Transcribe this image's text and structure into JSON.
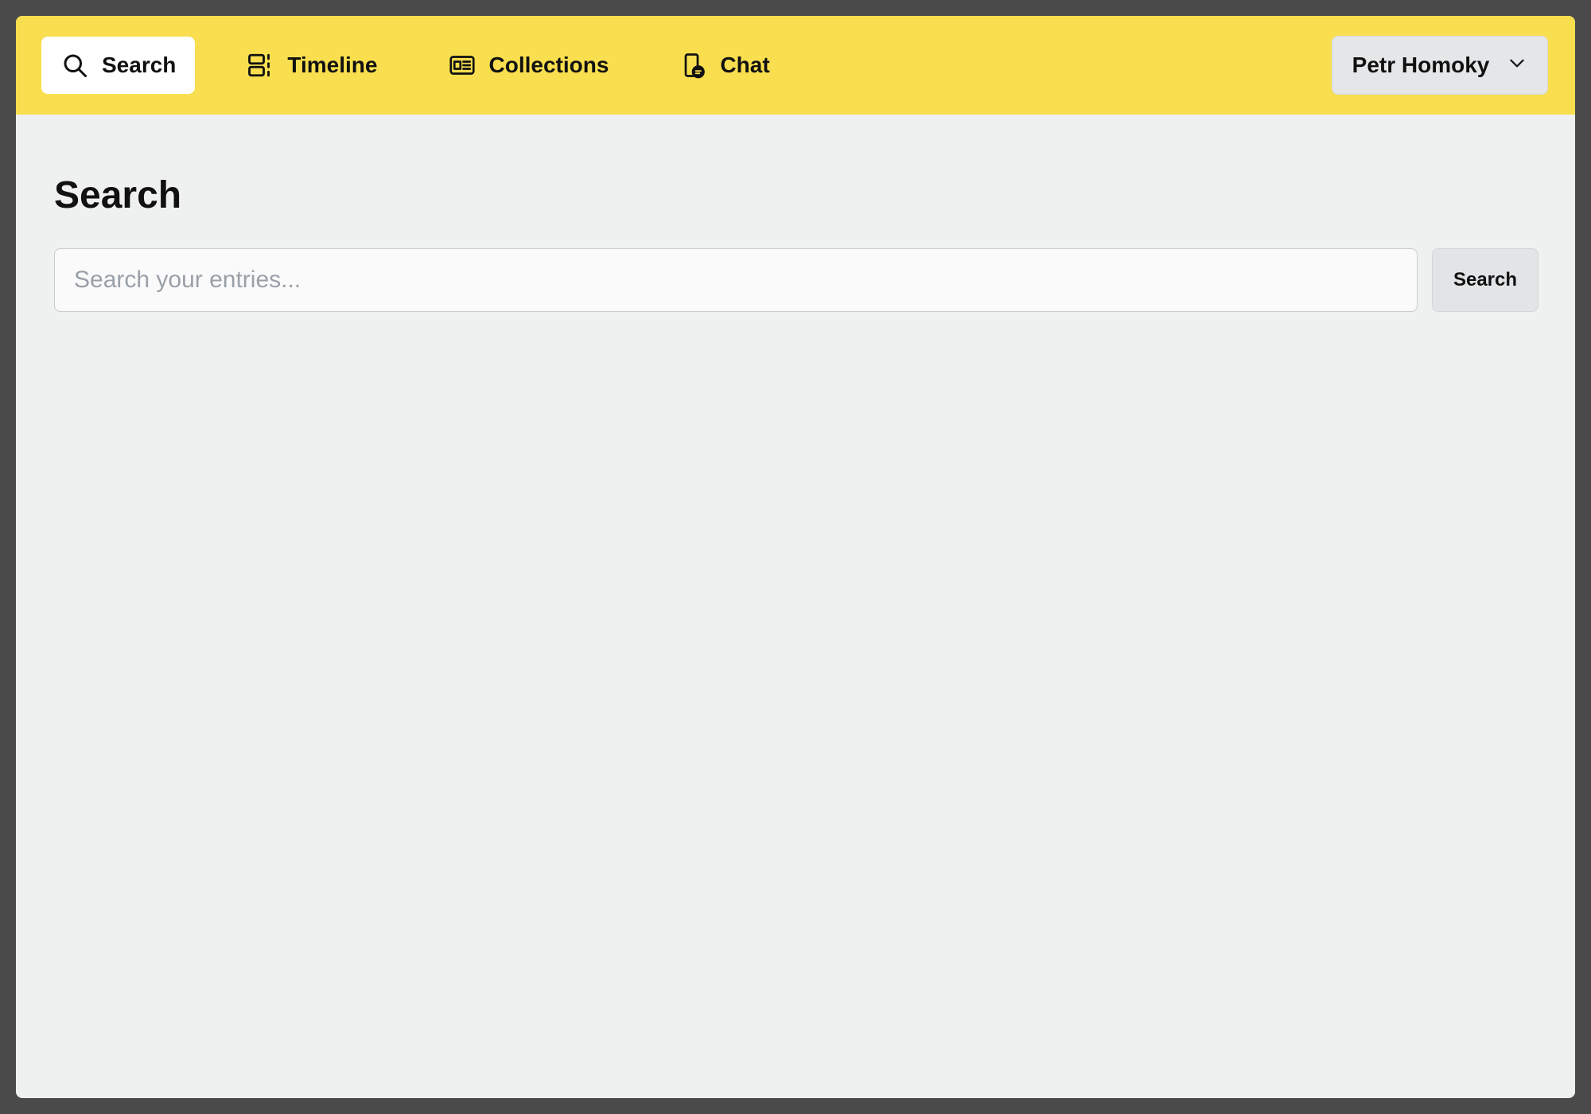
{
  "nav": {
    "items": [
      {
        "label": "Search",
        "icon": "search-icon",
        "active": true
      },
      {
        "label": "Timeline",
        "icon": "timeline-icon",
        "active": false
      },
      {
        "label": "Collections",
        "icon": "collections-icon",
        "active": false
      },
      {
        "label": "Chat",
        "icon": "chat-icon",
        "active": false
      }
    ]
  },
  "user": {
    "name": "Petr Homoky",
    "icon": "chevron-down-icon"
  },
  "page": {
    "title": "Search"
  },
  "search": {
    "placeholder": "Search your entries...",
    "value": "",
    "button_label": "Search"
  },
  "colors": {
    "topbar": "#f9df4f",
    "background": "#eff0f0",
    "frame": "#4a4a4a"
  }
}
